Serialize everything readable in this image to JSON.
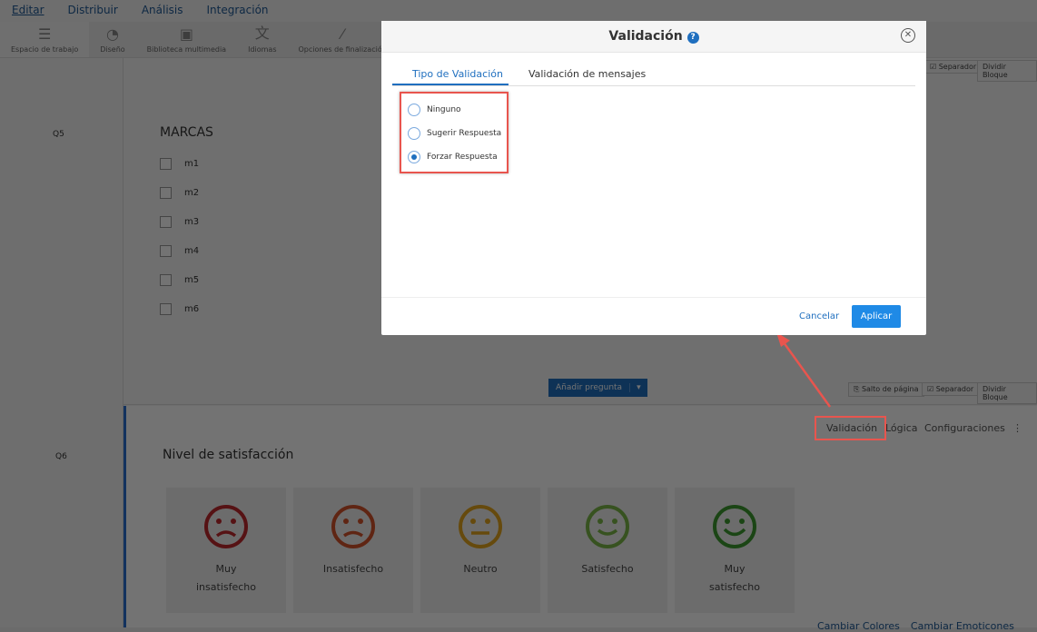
{
  "topnav": [
    "Editar",
    "Distribuir",
    "Análisis",
    "Integración"
  ],
  "toolbar": [
    "Espacio de trabajo",
    "Diseño",
    "Biblioteca multimedia",
    "Idiomas",
    "Opciones de finalización"
  ],
  "q5": {
    "label": "Q5",
    "title": "MARCAS",
    "options": [
      "m1",
      "m2",
      "m3",
      "m4",
      "m5",
      "m6"
    ]
  },
  "block_buttons": {
    "page_break": "Salto de página",
    "separator": "Separador",
    "split": "Dividir Bloque"
  },
  "add_question": "Añadir pregunta",
  "q6": {
    "label": "Q6",
    "title": "Nivel de satisfacción",
    "tabs": [
      "Validación",
      "Lógica",
      "Configuraciones"
    ],
    "faces": [
      {
        "l1": "Muy",
        "l2": "insatisfecho",
        "color": "#c0272d"
      },
      {
        "l1": "Insatisfecho",
        "l2": "",
        "color": "#d4522a"
      },
      {
        "l1": "Neutro",
        "l2": "",
        "color": "#e3a51c"
      },
      {
        "l1": "Satisfecho",
        "l2": "",
        "color": "#7ab648"
      },
      {
        "l1": "Muy",
        "l2": "satisfecho",
        "color": "#3d9a2f"
      }
    ],
    "links": [
      "Cambiar Colores",
      "Cambiar Emoticones"
    ]
  },
  "modal": {
    "title": "Validación",
    "help": "?",
    "tabs": [
      "Tipo de Validación",
      "Validación de mensajes"
    ],
    "options": [
      "Ninguno",
      "Sugerir Respuesta",
      "Forzar Respuesta"
    ],
    "selected": "Forzar Respuesta",
    "cancel": "Cancelar",
    "apply": "Aplicar"
  }
}
